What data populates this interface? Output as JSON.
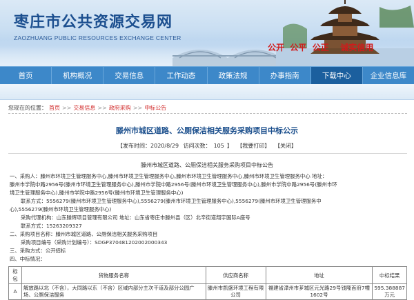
{
  "site": {
    "title": "枣庄市公共资源交易网",
    "subtitle": "ZAOZHUANG PUBLIC RESOURCES EXCHANGE CENTER",
    "slogan": "公开  公平  公正    诚实信用"
  },
  "nav": {
    "items": [
      {
        "label": "首页"
      },
      {
        "label": "机构概况"
      },
      {
        "label": "交易信息"
      },
      {
        "label": "工作动态"
      },
      {
        "label": "政策法规"
      },
      {
        "label": "办事指南"
      },
      {
        "label": "下载中心"
      },
      {
        "label": "企业信息库"
      }
    ]
  },
  "breadcrumb": {
    "prefix": "您现在的位置：",
    "items": [
      "首页",
      "交易信息",
      "政府采购",
      "中标公告"
    ],
    "separator": ">>"
  },
  "article": {
    "title": "滕州市城区道路、公厕保洁相关服务采购项目中标公示",
    "publish_label": "【发布时间：2020/8/29",
    "visits_label": "访问次数：",
    "visits": "105",
    "visits_end": "】",
    "print_label": "【我要打印】",
    "close_label": "【关闭】",
    "doc_title": "滕州市城区道路、公厕保洁相关服务采购项目中标公告",
    "lines": [
      "一、采购人：滕州市环境卫生管理服务中心,滕州市环境卫生管理服务中心,滕州市环境卫生管理服务中心,滕州市环境卫生管理服务中心    地址：",
      "滕州市学院中路2956号(滕州市环境卫生管理服务中心),滕州市学院中路2956号(滕州市环境卫生管理服务中心),滕州市学院中路2956号(滕州市环",
      "境卫生管理服务中心),滕州市学院中路2956号(滕州市环境卫生管理服务中心)",
      "联系方式：5556279(滕州市环境卫生管理服务中心),5556279(滕州市环境卫生管理服务中心),5556279(滕州市环境卫生管理服务中",
      "心),5556279(滕州市环境卫生管理服务中心)",
      "采购代理机构：山东滕辉项目管理有限公司      地址：山东省枣庄市滕州县（区）北辛街道翔宇国际A座号",
      "联系方式：15263209327",
      "二、采购项目名称：滕州市城区道路、公厕保洁相关服务采购项目",
      "采购项目编号（采购计划编号）：SDGP370481202002000343",
      "三、采购方式：公开招标",
      "四、中标情况："
    ]
  },
  "table": {
    "headers": [
      "标包",
      "货物服务名称",
      "供应商名称",
      "地址",
      "中标结果"
    ],
    "rows": [
      [
        "A",
        "解放路以北（不含），大同路以东（不含）区域内部分主次干道及部分公园广场、公厕保洁服务",
        "滕州市凯盛环境工程有限公司",
        "福建省漳州市芗城区元光路29号钱隆首府7幢1602号",
        "595.388887万元"
      ]
    ]
  },
  "colors": {
    "nav_bg": "#3d88c9",
    "nav_active": "#1b5f9e",
    "title_blue": "#1a4e8c",
    "link_red": "#d12b2b",
    "slogan_red": "#d11a1a"
  }
}
